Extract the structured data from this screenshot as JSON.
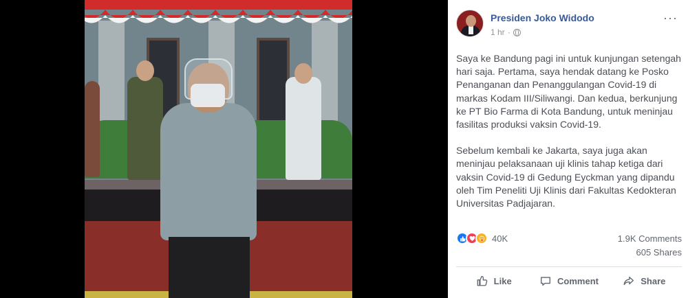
{
  "post": {
    "author": "Presiden Joko Widodo",
    "time": "1 hr",
    "separator": "·",
    "more": "···",
    "paragraphs": [
      "Saya ke Bandung pagi ini untuk kunjungan setengah hari saja. Pertama, saya hendak datang ke Posko Penanganan dan Penanggulangan Covid-19 di markas Kodam III/Siliwangi. Dan kedua, berkunjung ke PT Bio Farma di Kota Bandung, untuk meninjau fasilitas produksi vaksin Covid-19.",
      "Sebelum kembali ke Jakarta, saya juga akan meninjau pelaksanaan uji klinis tahap ketiga dari vaksin Covid-19 di Gedung Eyckman yang dipandu oleh Tim Peneliti Uji Klinis dari Fakultas Kedokteran Universitas Padjajaran."
    ],
    "reaction_count": "40K",
    "comments_count": "1.9K Comments",
    "shares_count": "605 Shares"
  },
  "actions": {
    "like": "Like",
    "comment": "Comment",
    "share": "Share"
  },
  "icons": {
    "privacy": "globe-icon",
    "reactions": [
      "like-reaction-icon",
      "love-reaction-icon",
      "care-reaction-icon"
    ]
  },
  "colors": {
    "author": "#385898",
    "like": "#1877f2",
    "love": "#f33e58",
    "care": "#f7b125"
  }
}
